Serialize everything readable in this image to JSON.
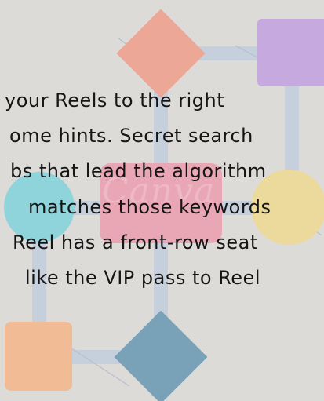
{
  "colors": {
    "background": "#dcdbd8",
    "connector": "#c6cfdc",
    "salmon": "#eda796",
    "lavender": "#c6a9de",
    "rose": "#e9a6b4",
    "teal": "#8fd3db",
    "butter": "#ecd99c",
    "peach": "#f1bb96",
    "steel": "#79a1b8",
    "text": "#151515"
  },
  "watermark": "Canva",
  "text_lines": [
    "your  Reels  to  the  right",
    "ome  hints.  Secret  search",
    "bs that lead the algorithm",
    "matches those keywords",
    "Reel has a front-row seat",
    "like  the  VIP  pass  to  Reel"
  ]
}
